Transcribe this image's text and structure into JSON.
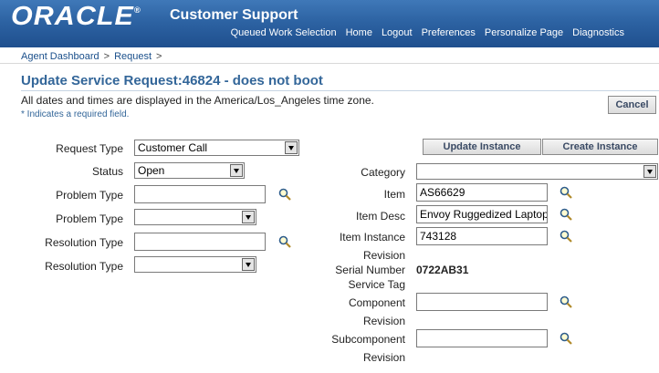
{
  "header": {
    "logo": "ORACLE",
    "app_title": "Customer Support",
    "global_links": [
      "Queued Work Selection",
      "Home",
      "Logout",
      "Preferences",
      "Personalize Page",
      "Diagnostics"
    ]
  },
  "breadcrumb": {
    "items": [
      "Agent Dashboard",
      "Request"
    ],
    "separator": ">"
  },
  "page": {
    "title": "Update Service Request:46824 - does not boot",
    "tz_note": "All dates and times are displayed in the America/Los_Angeles time zone.",
    "required_note": "* Indicates a required field.",
    "cancel_label": "Cancel"
  },
  "left_form": {
    "request_type": {
      "label": "Request Type",
      "value": "Customer Call"
    },
    "status": {
      "label": "Status",
      "value": "Open"
    },
    "problem_type_text": {
      "label": "Problem Type",
      "value": ""
    },
    "problem_type_select": {
      "label": "Problem Type",
      "value": ""
    },
    "resolution_type_text": {
      "label": "Resolution Type",
      "value": ""
    },
    "resolution_type_select": {
      "label": "Resolution Type",
      "value": ""
    }
  },
  "right_form": {
    "update_instance_label": "Update Instance",
    "create_instance_label": "Create Instance",
    "category": {
      "label": "Category",
      "value": ""
    },
    "item": {
      "label": "Item",
      "value": "AS66629"
    },
    "item_desc": {
      "label": "Item Desc",
      "value": "Envoy Ruggedized Laptop"
    },
    "item_instance": {
      "label": "Item Instance",
      "value": "743128"
    },
    "revision1": {
      "label": "Revision"
    },
    "serial_number": {
      "label": "Serial Number",
      "value": "0722AB31"
    },
    "service_tag": {
      "label": "Service Tag"
    },
    "component": {
      "label": "Component",
      "value": ""
    },
    "revision2": {
      "label": "Revision"
    },
    "subcomponent": {
      "label": "Subcomponent",
      "value": ""
    },
    "revision3": {
      "label": "Revision"
    }
  },
  "colors": {
    "header_blue": "#2d63a3",
    "title_blue": "#336699"
  }
}
